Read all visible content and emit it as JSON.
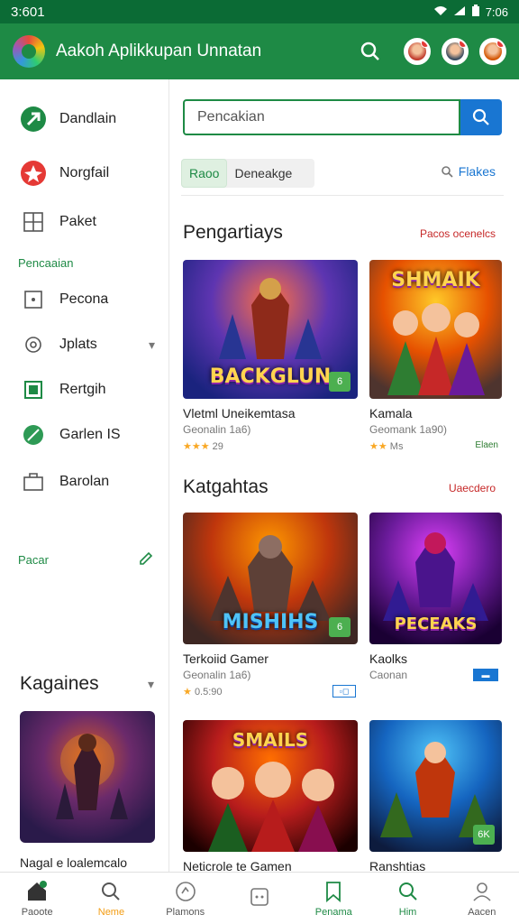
{
  "status_bar": {
    "time": "3:601",
    "right": "7:06"
  },
  "app_bar": {
    "title": "Aakoh Aplikkupan Unnatan",
    "search_icon": "search-icon",
    "avatars": [
      {
        "badge": "3",
        "accent": "#e53935"
      },
      {
        "badge": "",
        "accent": "#e53935"
      },
      {
        "badge": "",
        "accent": "#e53935"
      }
    ]
  },
  "sidebar": {
    "items": [
      {
        "label": "Dandlain",
        "icon": "arrow-icon",
        "color": "#1e8a45"
      },
      {
        "label": "Norgfail",
        "icon": "star-icon",
        "color": "#e53935"
      },
      {
        "label": "Paket",
        "icon": "grid-icon",
        "color": "#555555"
      }
    ],
    "section1": "Pencaaian",
    "items2": [
      {
        "label": "Pecona",
        "icon": "square-icon"
      },
      {
        "label": "Jplats",
        "icon": "puzzle-icon"
      },
      {
        "label": "Rertgih",
        "icon": "box-icon"
      },
      {
        "label": "Garlen IS",
        "icon": "leaf-icon"
      },
      {
        "label": "Barolan",
        "icon": "briefcase-icon"
      }
    ],
    "section2": "Pacar",
    "heading": "Kagaines",
    "thumb_label": "Nagal e loalemcalo"
  },
  "main": {
    "search_placeholder": "Pencakian",
    "chip_active": "Raoo",
    "chip_other": "Deneakge",
    "filter_link": "Flakes",
    "section1": {
      "title": "Pengartiays",
      "link": "Pacos ocenelcs"
    },
    "section2": {
      "title": "Katgahtas",
      "link": "Uaecdero"
    },
    "cards": [
      {
        "title": "Vletml Uneikemtasa",
        "sub": "Geonalin 1a6)",
        "rating": "★★★",
        "rating_text": "29",
        "art": "BACKGLUN",
        "badge": "6"
      },
      {
        "title": "Kamala",
        "sub": "Geomank 1a90)",
        "rating": "★★",
        "rating_text": "Ms",
        "art": "SHMAIK",
        "tag": "Elaen"
      },
      {
        "title": "Terkoiid Gamer",
        "sub": "Geonalin 1a6)",
        "rating": "★",
        "rating_text": "0.5:90",
        "art": "MISHIHS",
        "badge": "6",
        "tag": "box"
      },
      {
        "title": "Kaolks",
        "sub": "Caonan",
        "rating": "",
        "rating_text": "",
        "art": "PECEAKS",
        "tag": "box2"
      },
      {
        "title": "Neticrole te Gamen",
        "sub": "",
        "art": "SMAILS"
      },
      {
        "title": "Ranshtias",
        "sub": "",
        "art": "",
        "badge": "6K"
      }
    ]
  },
  "bottom_nav": [
    {
      "label": "Paoote",
      "icon": "home-icon",
      "color": "#333"
    },
    {
      "label": "Neme",
      "icon": "search-icon",
      "color": "#f39c12"
    },
    {
      "label": "Plamons",
      "icon": "globe-icon",
      "color": "#777"
    },
    {
      "label": "",
      "icon": "square-icon",
      "color": "#777"
    },
    {
      "label": "Penama",
      "icon": "bookmark-icon",
      "color": "#1e8a45"
    },
    {
      "label": "Him",
      "icon": "search-icon",
      "color": "#1e8a45"
    },
    {
      "label": "Aacen",
      "icon": "profile-icon",
      "color": "#777"
    }
  ]
}
